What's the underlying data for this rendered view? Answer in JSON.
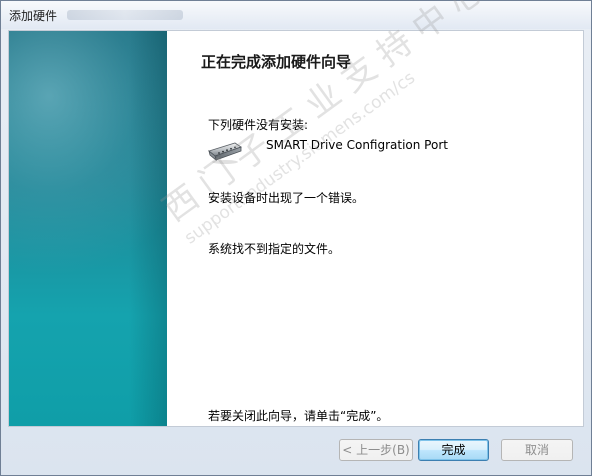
{
  "window": {
    "title": "添加硬件"
  },
  "wizard": {
    "heading": "正在完成添加硬件向导",
    "not_installed_label": "下列硬件没有安装:",
    "device_name": "SMART Drive Configration Port",
    "device_icon": "serial-port-connector-icon",
    "error_text": "安装设备时出现了一个错误。",
    "detail_text": "系统找不到指定的文件。",
    "close_hint": "若要关闭此向导，请单击“完成”。"
  },
  "watermark": {
    "chinese": "西门子工业支持中心",
    "url": "support.industry.siemens.com/cs"
  },
  "buttons": {
    "back_label": "< 上一步(B)",
    "finish_label": "完成",
    "cancel_label": "取消"
  },
  "colors": {
    "side_panel": "#1f8796",
    "default_button_border": "#3c7fb1"
  }
}
